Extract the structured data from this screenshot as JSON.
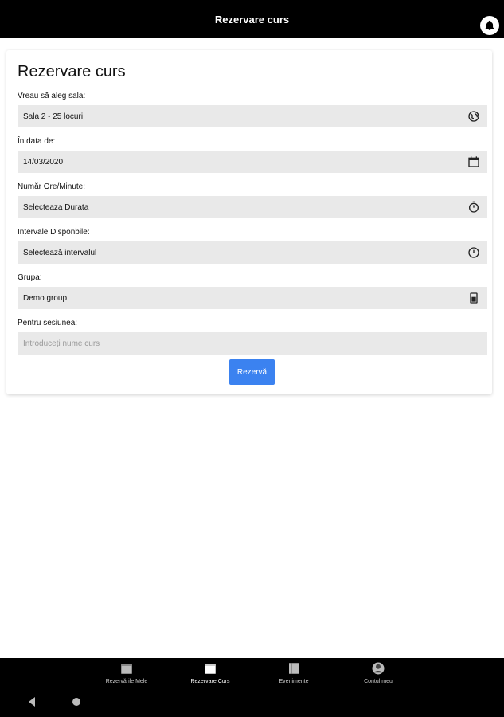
{
  "header": {
    "title": "Rezervare curs",
    "notification_icon": "bell-icon"
  },
  "form": {
    "heading": "Rezervare curs",
    "fields": [
      {
        "label": "Vreau să aleg sala:",
        "value": "Sala 2 - 25 locuri",
        "icon": "globe-icon"
      },
      {
        "label": "În data de:",
        "value": "14/03/2020",
        "icon": "calendar-icon"
      },
      {
        "label": "Număr Ore/Minute:",
        "value": "Selecteaza Durata",
        "icon": "stopwatch-icon"
      },
      {
        "label": "Intervale Disponbile:",
        "value": "Selectează intervalul",
        "icon": "clock-icon"
      },
      {
        "label": "Grupa:",
        "value": "Demo group",
        "icon": "trash-icon"
      },
      {
        "label": "Pentru sesiunea:",
        "placeholder": "Introduceți nume curs"
      }
    ],
    "submit_label": "Rezervă"
  },
  "bottom_nav": [
    {
      "label": "Rezervările Mele",
      "icon": "calendar-icon",
      "active": false
    },
    {
      "label": "Rezervare Curs",
      "icon": "calendar-icon",
      "active": true
    },
    {
      "label": "Evenimente",
      "icon": "book-icon",
      "active": false
    },
    {
      "label": "Contul meu",
      "icon": "user-icon",
      "active": false
    }
  ],
  "colors": {
    "topbar": "#000000",
    "field_bg": "#e9e9e9",
    "primary": "#3b82f0"
  }
}
